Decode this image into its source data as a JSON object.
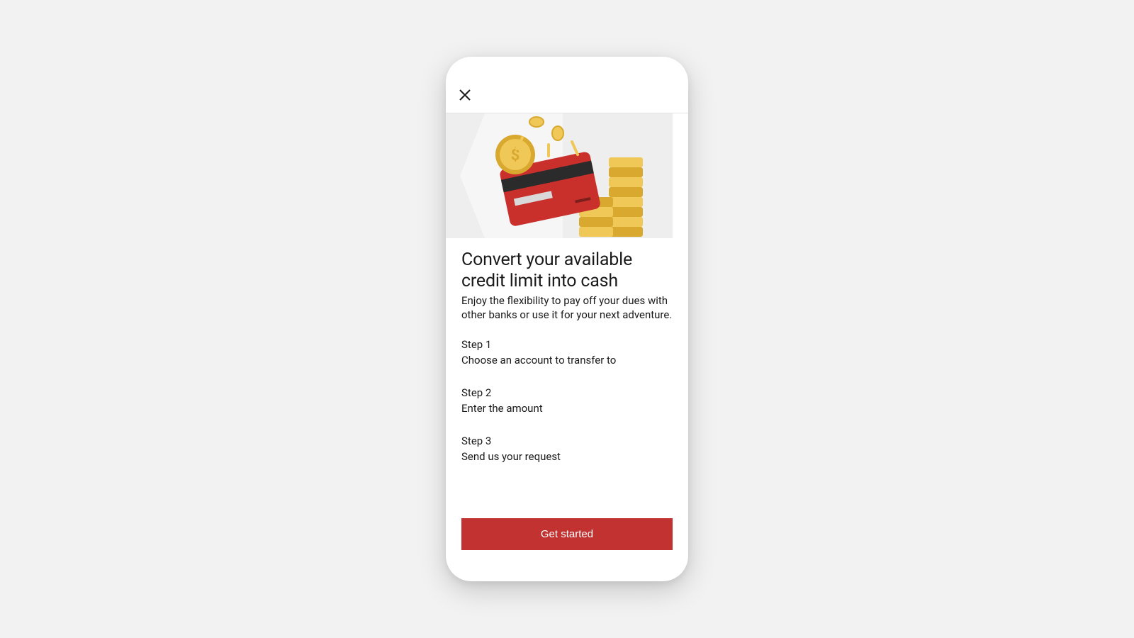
{
  "header": {
    "close_icon": "close"
  },
  "hero": {
    "alt": "credit-card-cash-illustration"
  },
  "title": "Convert your available credit limit into cash",
  "subtitle": "Enjoy the flexibility to pay off your dues with other banks or use it for your next adventure.",
  "steps": [
    {
      "label": "Step 1",
      "desc": "Choose an account to transfer to"
    },
    {
      "label": "Step 2",
      "desc": "Enter the amount"
    },
    {
      "label": "Step 3",
      "desc": "Send us your request"
    }
  ],
  "cta": {
    "label": "Get started"
  },
  "colors": {
    "primary": "#c23230",
    "background": "#f2f2f2",
    "hero_bg": "#eeeeee"
  }
}
